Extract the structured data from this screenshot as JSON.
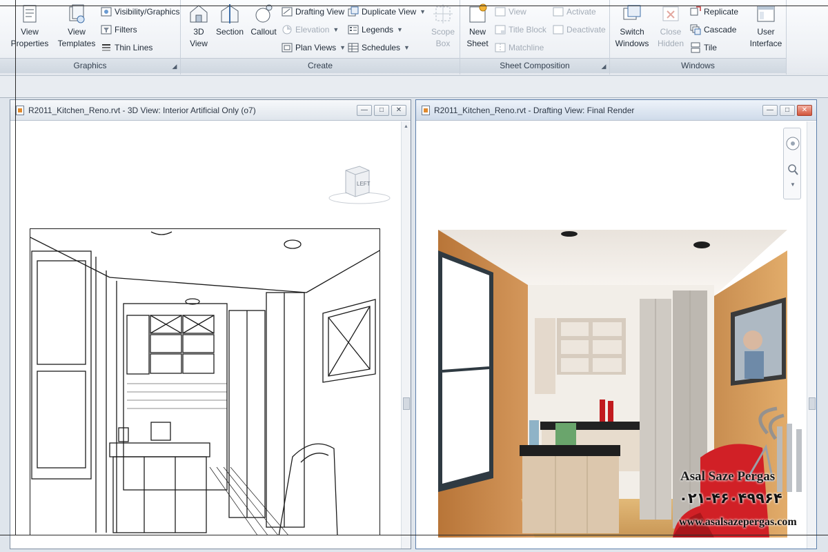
{
  "ribbon": {
    "graphics": {
      "title": "Graphics",
      "view_properties": "View Properties",
      "view_templates": "View Templates",
      "visibility_graphics": "Visibility/Graphics",
      "filters": "Filters",
      "thin_lines": "Thin Lines"
    },
    "create": {
      "title": "Create",
      "view_3d": "3D View",
      "section": "Section",
      "callout": "Callout",
      "drafting_view": "Drafting View",
      "elevation": "Elevation",
      "plan_views": "Plan Views",
      "duplicate_view": "Duplicate View",
      "legends": "Legends",
      "schedules": "Schedules",
      "scope_box": "Scope Box"
    },
    "sheet_composition": {
      "title": "Sheet Composition",
      "new_sheet": "New Sheet",
      "view": "View",
      "title_block": "Title Block",
      "matchline": "Matchline",
      "activate": "Activate",
      "deactivate": "Deactivate"
    },
    "windows": {
      "title": "Windows",
      "switch_windows": "Switch Windows",
      "close_hidden": "Close Hidden",
      "replicate": "Replicate",
      "cascade": "Cascade",
      "tile": "Tile",
      "user_interface": "User Interface"
    }
  },
  "left_window": {
    "title": "R2011_Kitchen_Reno.rvt - 3D View: Interior Artificial Only (o7)",
    "viewcube_face": "LEFT"
  },
  "right_window": {
    "title": "R2011_Kitchen_Reno.rvt - Drafting View: Final Render"
  },
  "watermark": {
    "company": "Asal Saze Pergas",
    "phone": "۰۲۱-۴۶۰۴۹۹۶۴",
    "website": "www.asalsazepergas.com"
  },
  "colors": {
    "ribbon_bg": "#eef1f5",
    "active_border": "#5d7fab",
    "close_red": "#d2553c",
    "render_wall": "#c98a4d",
    "render_chair": "#d12026"
  }
}
